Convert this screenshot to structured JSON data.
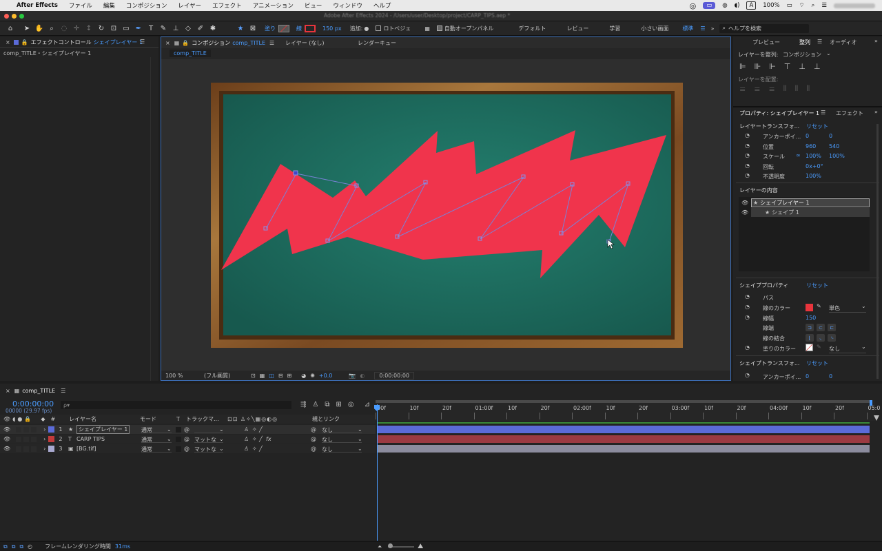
{
  "menubar": {
    "app_name": "After Effects",
    "items": [
      "ファイル",
      "編集",
      "コンポジション",
      "レイヤー",
      "エフェクト",
      "アニメーション",
      "ビュー",
      "ウィンドウ",
      "ヘルプ"
    ],
    "battery": "100%",
    "input_mode": "A"
  },
  "window": {
    "title": "Adobe After Effects 2024 - /Users/user/Desktop/project/CARP_TIPS.aep *"
  },
  "toolbar": {
    "fill_label": "塗り",
    "stroke_label": "線",
    "stroke_width": "150 px",
    "add_label": "追加:",
    "rotobezier_label": "ロトベジェ",
    "auto_open_label": "自動オープンパネル",
    "workspaces": [
      "デフォルト",
      "レビュー",
      "学習",
      "小さい画面",
      "標準"
    ],
    "help_placeholder": "ヘルプを検索"
  },
  "effects_panel": {
    "tab_label": "エフェクトコントロール",
    "tab_layer": "シェイプレイヤー 1",
    "breadcrumb": "comp_TITLE・シェイプレイヤー 1"
  },
  "comp_panel": {
    "tabs": [
      "コンポジション",
      "レイヤー (なし)",
      "レンダーキュー"
    ],
    "comp_name": "comp_TITLE",
    "subtab": "comp_TITLE",
    "zoom": "100 %",
    "quality": "(フル画質)",
    "exposure": "+0.0",
    "timecode": "0:00:00:00"
  },
  "right_panel": {
    "tabs": [
      "プレビュー",
      "整列",
      "オーディオ"
    ],
    "align_to_label": "レイヤーを整列:",
    "align_to_value": "コンポジション",
    "distribute_label": "レイヤーを配置:",
    "props_tab": "プロパティ: シェイプレイヤー 1",
    "effect_tab": "エフェクト",
    "layer_transform": "レイヤートランスフォ...",
    "reset": "リセット",
    "anchor_label": "アンカーポイ...",
    "anchor_x": "0",
    "anchor_y": "0",
    "position_label": "位置",
    "position_x": "960",
    "position_y": "540",
    "scale_label": "スケール",
    "scale_x": "100%",
    "scale_y": "100%",
    "rotation_label": "回転",
    "rotation_value": "0x+0°",
    "opacity_label": "不透明度",
    "opacity_value": "100%",
    "contents_title": "レイヤーの内容",
    "content_items": [
      "シェイプレイヤー 1",
      "シェイプ 1"
    ],
    "shape_props_title": "シェイププロパティ",
    "path_label": "パス",
    "stroke_color_label": "線のカラー",
    "stroke_type": "単色",
    "stroke_width_label": "線幅",
    "stroke_width_value": "150",
    "line_cap_label": "線端",
    "line_join_label": "線の結合",
    "fill_color_label": "塗りのカラー",
    "fill_value": "なし",
    "shape_transform": "シェイプトランスフォ...",
    "anchor2_x": "0",
    "anchor2_y": "0",
    "stroke_color": "#e8343c"
  },
  "timeline": {
    "comp_tab": "comp_TITLE",
    "timecode": "0:00:00:00",
    "fps": "00000 (29.97 fps)",
    "search_placeholder": "ρ▾",
    "col_hash": "#",
    "col_layer_name": "レイヤー名",
    "col_mode": "モード",
    "col_t": "T",
    "col_track": "トラックマ...",
    "col_parent": "親とリンク",
    "ruler": [
      "00f",
      "10f",
      "20f",
      "01:00f",
      "10f",
      "20f",
      "02:00f",
      "10f",
      "20f",
      "03:00f",
      "10f",
      "20f",
      "04:00f",
      "10f",
      "20f",
      "05:0"
    ],
    "layers": [
      {
        "num": "1",
        "name": "シェイプレイヤー 1",
        "type": "★",
        "mode": "通常",
        "track": "",
        "parent": "なし",
        "color": "#5b6bd8",
        "bar": "#5b6bd8"
      },
      {
        "num": "2",
        "name": "CARP TIPS",
        "type": "T",
        "mode": "通常",
        "track": "マットな",
        "parent": "なし",
        "color": "#c23a3a",
        "bar": "#9b3a42"
      },
      {
        "num": "3",
        "name": "[BG.tif]",
        "type": "▣",
        "mode": "通常",
        "track": "マットな",
        "parent": "なし",
        "color": "#a9a9d0",
        "bar": "#8c8c9e"
      }
    ]
  },
  "status": {
    "render_label": "フレームレンダリング時間",
    "render_time": "31ms"
  },
  "colors": {
    "accent": "#4a9cff",
    "board": "#1e6b5e",
    "frame": "#8b5a2b",
    "shape": "#f0344c"
  }
}
